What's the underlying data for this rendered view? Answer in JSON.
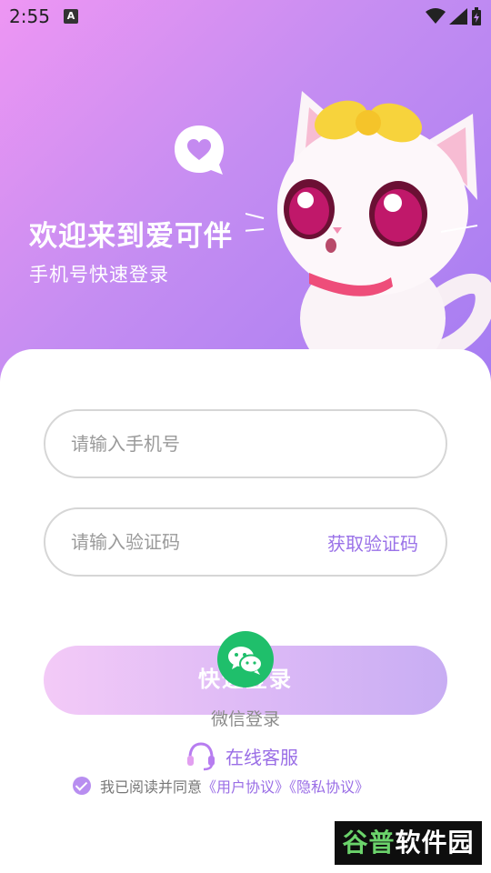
{
  "status_bar": {
    "time": "2:55",
    "a_icon": "A"
  },
  "hero": {
    "title": "欢迎来到爱可伴",
    "subtitle": "手机号快速登录"
  },
  "form": {
    "phone_placeholder": "请输入手机号",
    "code_placeholder": "请输入验证码",
    "get_code_label": "获取验证码",
    "login_label": "快速登录"
  },
  "wechat": {
    "label": "微信登录"
  },
  "service": {
    "label": "在线客服"
  },
  "agreement": {
    "prefix": "我已阅读并同意",
    "user_agreement": "《用户协议》",
    "privacy_policy": "《隐私协议》"
  },
  "watermark": {
    "part1": "谷普",
    "part2": "软件园"
  },
  "colors": {
    "accent": "#9a6ee6",
    "wechat_green": "#1fbf6b",
    "gradient_start": "#ee96f3",
    "gradient_end": "#a57cf2"
  }
}
